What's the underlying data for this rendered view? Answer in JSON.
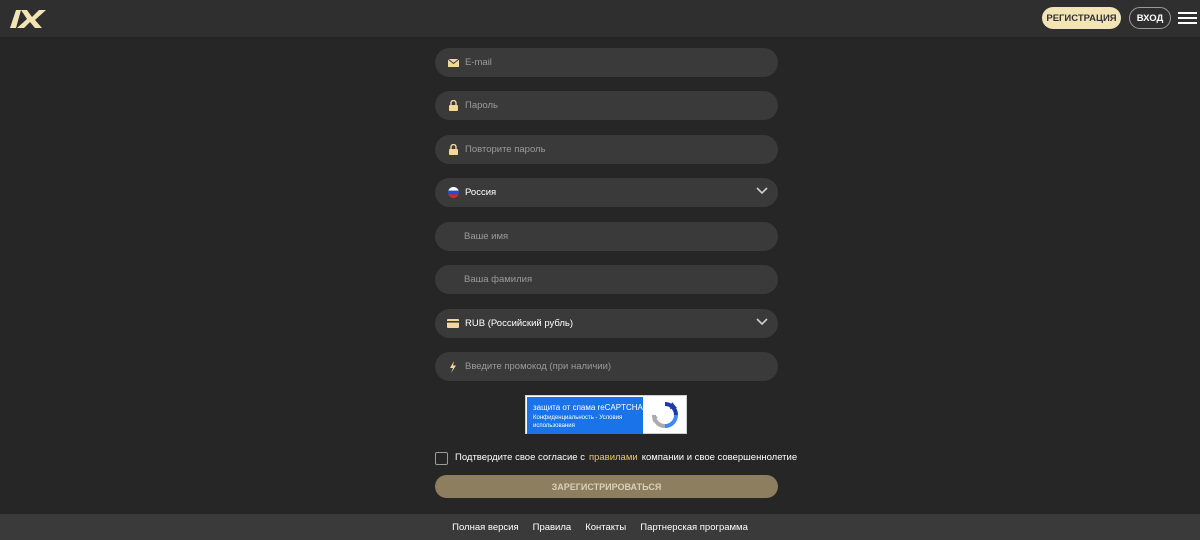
{
  "header": {
    "logo_text": "1X",
    "register_label": "РЕГИСТРАЦИЯ",
    "login_label": "ВХОД"
  },
  "form": {
    "email_placeholder": "E-mail",
    "password_placeholder": "Пароль",
    "repeat_password_placeholder": "Повторите пароль",
    "country_value": "Россия",
    "first_name_placeholder": "Ваше имя",
    "last_name_placeholder": "Ваша фамилия",
    "currency_value": "RUB (Российский рубль)",
    "promo_placeholder": "Введите промокод (при наличии)",
    "captcha_title": "защита от спама reCAPTCHA",
    "captcha_links": "Конфиденциальность - Условия использования",
    "consent_before": "Подтвердите свое согласие с",
    "consent_link": "правилами",
    "consent_after": "компании и свое совершеннолетие",
    "submit_label": "ЗАРЕГИСТРИРОВАТЬСЯ"
  },
  "footer": {
    "links": [
      "Полная версия",
      "Правила",
      "Контакты",
      "Партнерская программа"
    ]
  },
  "colors": {
    "accent": "#f2e4b4",
    "link": "#e8c46a",
    "submit_bg": "#8c7e5e",
    "background": "#262626"
  }
}
